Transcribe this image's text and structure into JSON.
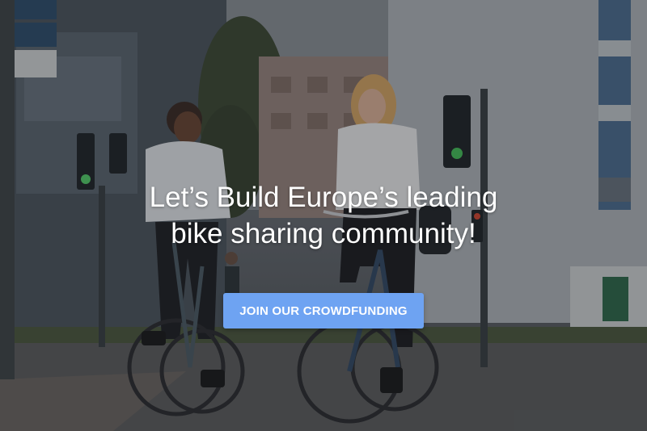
{
  "hero": {
    "headline_line1": "Let’s Build Europe’s leading",
    "headline_line2": "bike sharing community!",
    "cta_label": "JOIN OUR CROWDFUNDING"
  },
  "colors": {
    "cta_background": "#6ea3f2",
    "overlay": "#14181e",
    "text": "#ffffff"
  },
  "background_image": {
    "description_icon": "photo-two-cyclists-city-street"
  }
}
